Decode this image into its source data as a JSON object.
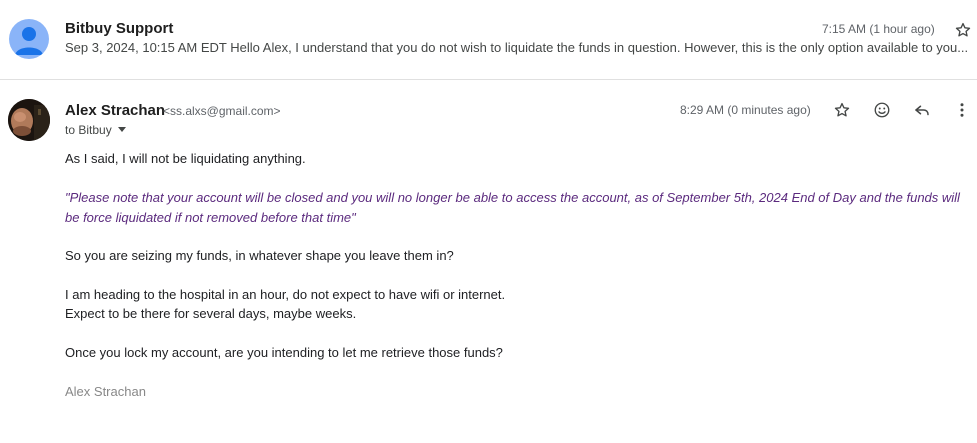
{
  "thread": [
    {
      "sender": "Bitbuy Support",
      "time": "7:15 AM (1 hour ago)",
      "snippet": "Sep 3, 2024, 10:15 AM EDT Hello Alex, I understand that you do not wish to liquidate the funds in question. However, this is the only option available to you..."
    },
    {
      "sender": "Alex Strachan",
      "email": "<ss.alxs@gmail.com>",
      "to_prefix": "to",
      "to": "Bitbuy",
      "time": "8:29 AM (0 minutes ago)",
      "body": {
        "p1": "As I said, I will not be liquidating anything.",
        "quote": "\"Please note that your account will be closed and you will no longer be able to access the account, as of September 5th, 2024 End of Day and the funds will be force liquidated if not removed before that time\"",
        "p3": "So you are seizing my funds, in whatever shape you leave them in?",
        "p4": "I am heading to the hospital in an hour, do not expect to have wifi or internet.",
        "p5": "Expect to be there for several days, maybe weeks.",
        "p6": "Once you lock my account, are you intending to let me retrieve those funds?"
      },
      "signature": "Alex Strachan"
    }
  ],
  "icons": {
    "avatar_default": "person-icon",
    "star": "star-icon",
    "emoji": "emoji-icon",
    "reply": "reply-icon",
    "more": "more-vert-icon",
    "caret": "chevron-down-icon"
  },
  "colors": {
    "quote_text": "#5b2a7e",
    "avatar_bg": "#8ab4f8",
    "avatar_fg": "#1a73e8",
    "signature": "#888888"
  }
}
